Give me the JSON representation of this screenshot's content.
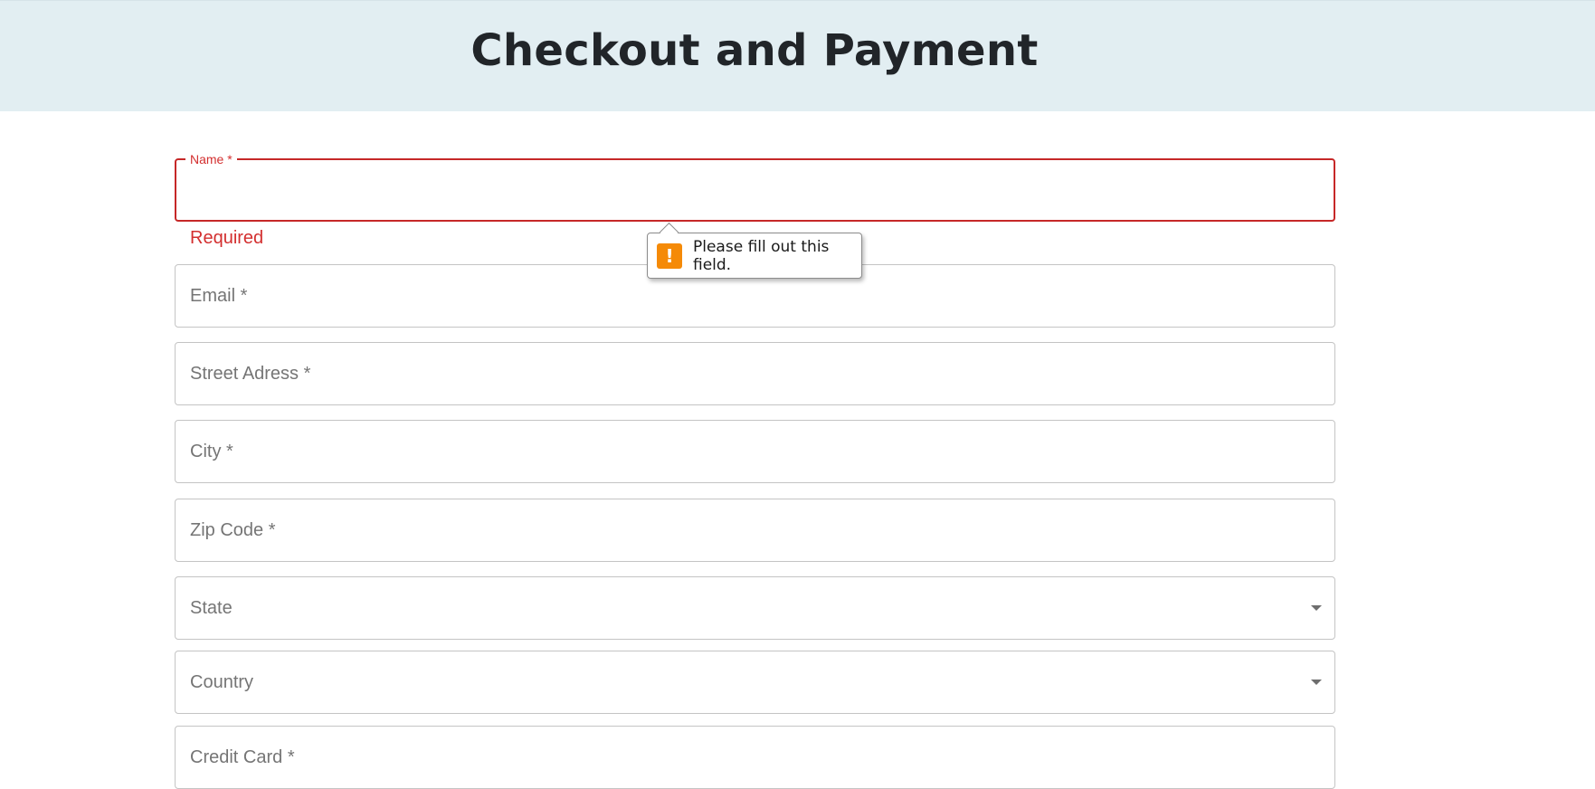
{
  "header": {
    "title": "Checkout and Payment",
    "background": "#e2eef2"
  },
  "form": {
    "name": {
      "label": "Name *",
      "value": "",
      "helper": "Required",
      "error_color": "#d32f2f"
    },
    "email": {
      "placeholder": "Email *"
    },
    "street": {
      "placeholder": "Street Adress *"
    },
    "city": {
      "placeholder": "City *"
    },
    "zip": {
      "placeholder": "Zip Code *"
    },
    "state": {
      "placeholder": "State",
      "icon": "dropdown-caret-icon"
    },
    "country": {
      "placeholder": "Country",
      "icon": "dropdown-caret-icon"
    },
    "credit_card": {
      "placeholder": "Credit Card  *"
    }
  },
  "validation_tooltip": {
    "message": "Please fill out this field.",
    "icon": "warning-icon",
    "icon_color": "#f58a07"
  }
}
